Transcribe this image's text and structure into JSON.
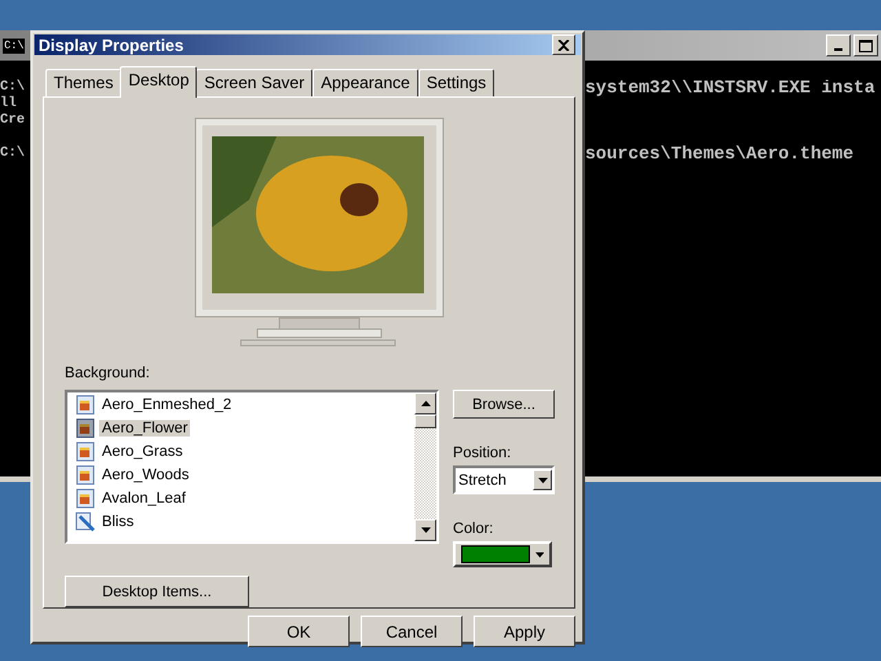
{
  "console_window": {
    "icon_text": "C:\\",
    "lines": [
      {
        "left": "C:\\",
        "right": "system32\\\\INSTSRV.EXE insta"
      },
      {
        "left": "ll"
      },
      {
        "left": "Cre"
      },
      {
        "left": "C:\\",
        "right": "sources\\Themes\\Aero.theme",
        "blank_line_before": true
      }
    ]
  },
  "dialog": {
    "title": "Display Properties",
    "tabs": [
      {
        "label": "Themes",
        "selected": false
      },
      {
        "label": "Desktop",
        "selected": true
      },
      {
        "label": "Screen Saver",
        "selected": false
      },
      {
        "label": "Appearance",
        "selected": false
      },
      {
        "label": "Settings",
        "selected": false
      }
    ],
    "background_label": "Background:",
    "backgrounds": [
      {
        "name": "Aero_Enmeshed_2",
        "kind": "page",
        "selected": false
      },
      {
        "name": "Aero_Flower",
        "kind": "page",
        "selected": true
      },
      {
        "name": "Aero_Grass",
        "kind": "page",
        "selected": false
      },
      {
        "name": "Aero_Woods",
        "kind": "page",
        "selected": false
      },
      {
        "name": "Avalon_Leaf",
        "kind": "page",
        "selected": false
      },
      {
        "name": "Bliss",
        "kind": "picture",
        "selected": false
      }
    ],
    "browse_button": "Browse...",
    "position_label": "Position:",
    "position_value": "Stretch",
    "color_label": "Color:",
    "color": "#008000",
    "desktop_items_button": "Desktop Items...",
    "buttons": [
      "OK",
      "Cancel",
      "Apply"
    ]
  }
}
